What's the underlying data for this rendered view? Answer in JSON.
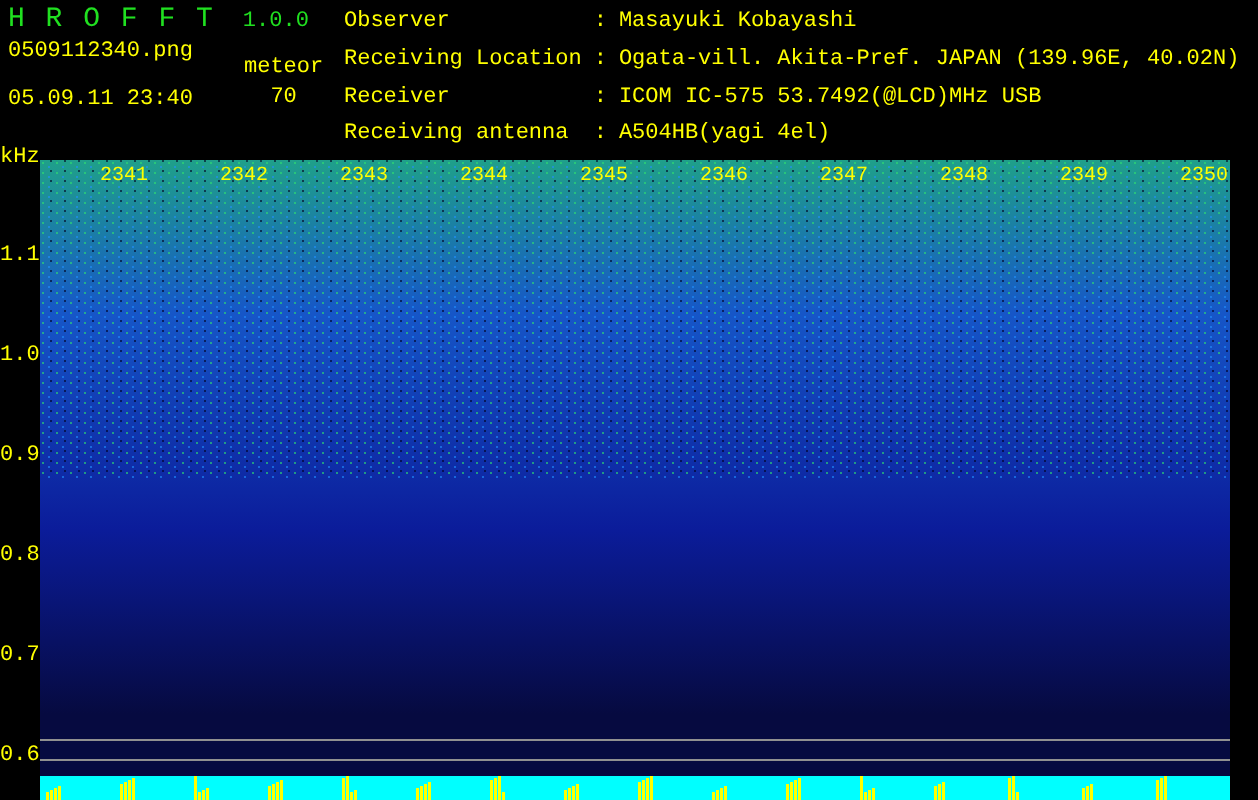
{
  "app": {
    "title": "H R O F F T",
    "version": "1.0.0",
    "filename": "0509112340.png",
    "datetime": "05.09.11 23:40",
    "meteor_label": "meteor",
    "meteor_count": "70"
  },
  "station": [
    {
      "label": "Observer",
      "separator": ":",
      "value": "Masayuki Kobayashi"
    },
    {
      "label": "Receiving Location",
      "separator": ":",
      "value": "Ogata-vill. Akita-Pref. JAPAN (139.96E, 40.02N)"
    },
    {
      "label": "Receiver",
      "separator": ":",
      "value": "ICOM IC-575 53.7492(@LCD)MHz USB"
    },
    {
      "label": "Receiving antenna",
      "separator": ":",
      "value": "A504HB(yagi 4el)"
    }
  ],
  "spectrogram": {
    "y_unit": "kHz",
    "y_labels": [
      "1.1",
      "1.0",
      "0.9",
      "0.8",
      "0.7",
      "0.6"
    ],
    "time_labels": [
      "2341",
      "2342",
      "2343",
      "2344",
      "2345",
      "2346",
      "2347",
      "2348",
      "2349",
      "2350"
    ]
  }
}
